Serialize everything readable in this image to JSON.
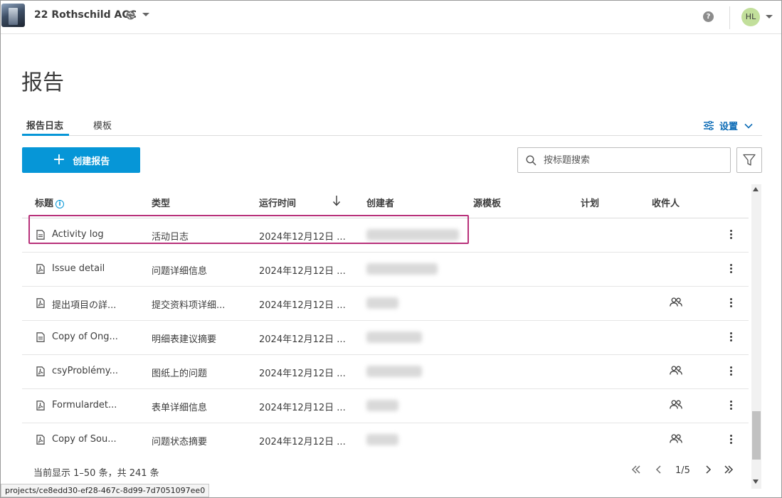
{
  "header": {
    "project_name": "22 Rothschild ACC",
    "help_label": "?",
    "avatar_initials": "HL"
  },
  "page": {
    "title": "报告"
  },
  "tabs": [
    {
      "label": "报告日志",
      "active": true
    },
    {
      "label": "模板",
      "active": false
    }
  ],
  "settings_label": "设置",
  "create_button_label": "创建报告",
  "search": {
    "placeholder": "按标题搜索",
    "value": ""
  },
  "table": {
    "columns": [
      "标题",
      "类型",
      "运行时间",
      "创建者",
      "源模板",
      "计划",
      "收件人"
    ],
    "rows": [
      {
        "title": "Activity log",
        "type": "活动日志",
        "run_time": "2024年12月12日 ...",
        "has_recipients": false,
        "icon": "document-icon"
      },
      {
        "title": "Issue detail",
        "type": "问题详细信息",
        "run_time": "2024年12月12日 ...",
        "has_recipients": false,
        "icon": "pdf-icon"
      },
      {
        "title": "提出項目の詳...",
        "type": "提交资料项详细...",
        "run_time": "2024年12月12日 ...",
        "has_recipients": true,
        "icon": "pdf-icon"
      },
      {
        "title": "Copy of Ong...",
        "type": "明细表建议摘要",
        "run_time": "2024年12月12日 ...",
        "has_recipients": false,
        "icon": "document-icon"
      },
      {
        "title": "csyProblémy...",
        "type": "图纸上的问题",
        "run_time": "2024年12月12日 ...",
        "has_recipients": true,
        "icon": "pdf-icon"
      },
      {
        "title": "Formulardet...",
        "type": "表单详细信息",
        "run_time": "2024年12月12日 ...",
        "has_recipients": true,
        "icon": "pdf-icon"
      },
      {
        "title": "Copy of Sou...",
        "type": "问题状态摘要",
        "run_time": "2024年12月12日 ...",
        "has_recipients": true,
        "icon": "pdf-icon"
      }
    ]
  },
  "footer": {
    "count_text": "当前显示 1–50 条，共 241 条",
    "page_indicator": "1/5"
  },
  "status_url": "projects/ce8edd30-ef28-467c-8d99-7d7051097ee0",
  "colors": {
    "accent": "#0696d7",
    "highlight": "#b8317a",
    "link": "#0a6ab5"
  }
}
